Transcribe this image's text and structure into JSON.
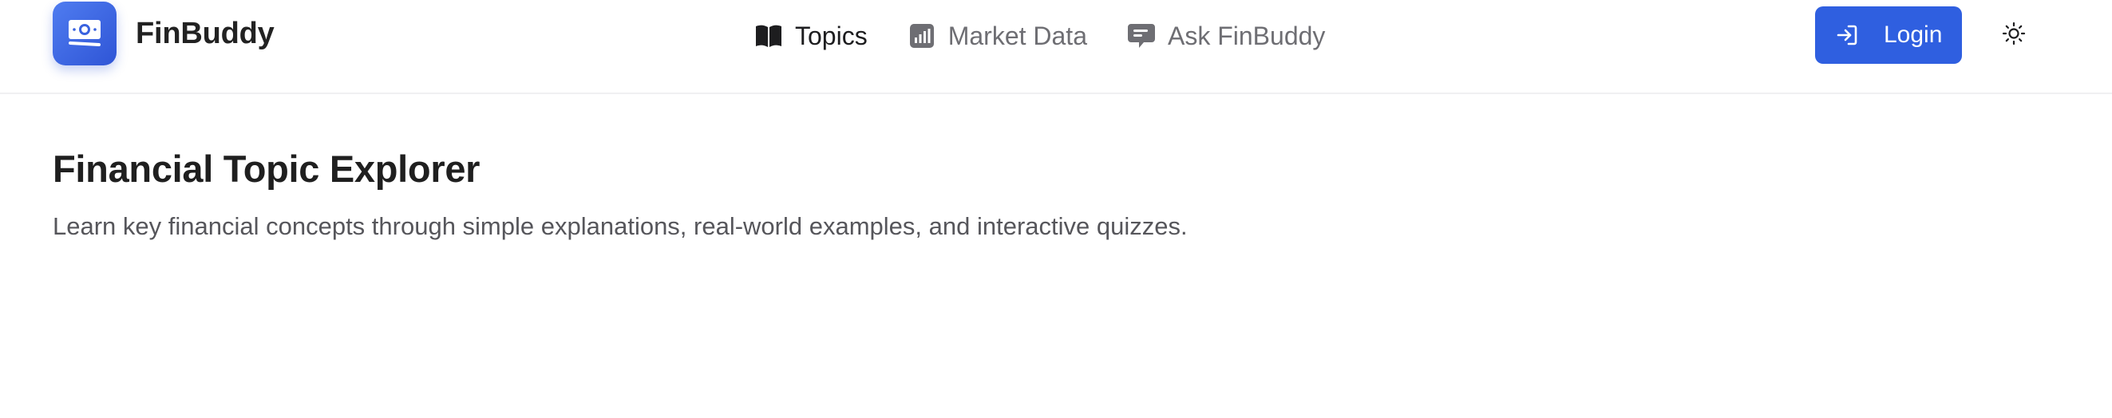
{
  "brand": {
    "name": "FinBuddy",
    "logo_icon": "banknote-icon"
  },
  "nav": {
    "items": [
      {
        "label": "Topics",
        "icon": "book-open-icon",
        "active": true
      },
      {
        "label": "Market Data",
        "icon": "bar-chart-icon",
        "active": false
      },
      {
        "label": "Ask FinBuddy",
        "icon": "chat-bubble-icon",
        "active": false
      }
    ]
  },
  "auth": {
    "login_label": "Login",
    "login_icon": "log-in-icon"
  },
  "theme_toggle": {
    "icon": "sun-icon"
  },
  "main": {
    "title": "Financial Topic Explorer",
    "subtitle": "Learn key financial concepts through simple explanations, real-world examples, and interactive quizzes."
  },
  "colors": {
    "accent": "#2f5fe0",
    "nav_active": "#1d1d1f",
    "nav_inactive": "#6e6e73",
    "subtitle": "#56565b"
  }
}
